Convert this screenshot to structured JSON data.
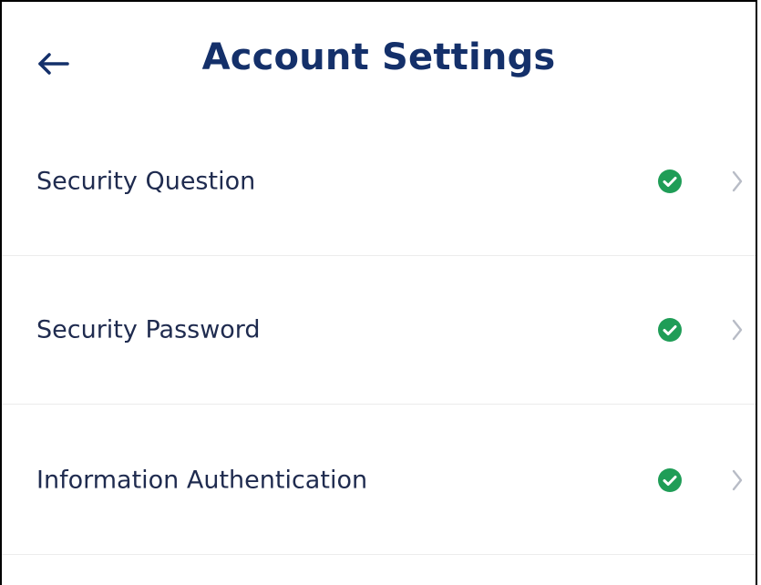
{
  "header": {
    "title": "Account Settings",
    "back_icon": "arrow-left-icon"
  },
  "settings": {
    "items": [
      {
        "label": "Security Question",
        "status_icon": "check-circle-icon",
        "status_color": "#1f9d57",
        "chevron_icon": "chevron-right-icon"
      },
      {
        "label": "Security Password",
        "status_icon": "check-circle-icon",
        "status_color": "#1f9d57",
        "chevron_icon": "chevron-right-icon"
      },
      {
        "label": "Information Authentication",
        "status_icon": "check-circle-icon",
        "status_color": "#1f9d57",
        "chevron_icon": "chevron-right-icon"
      }
    ]
  },
  "colors": {
    "title": "#14306a",
    "text": "#1f2b4f",
    "divider": "#ececec",
    "chevron": "#b8bcc6"
  }
}
